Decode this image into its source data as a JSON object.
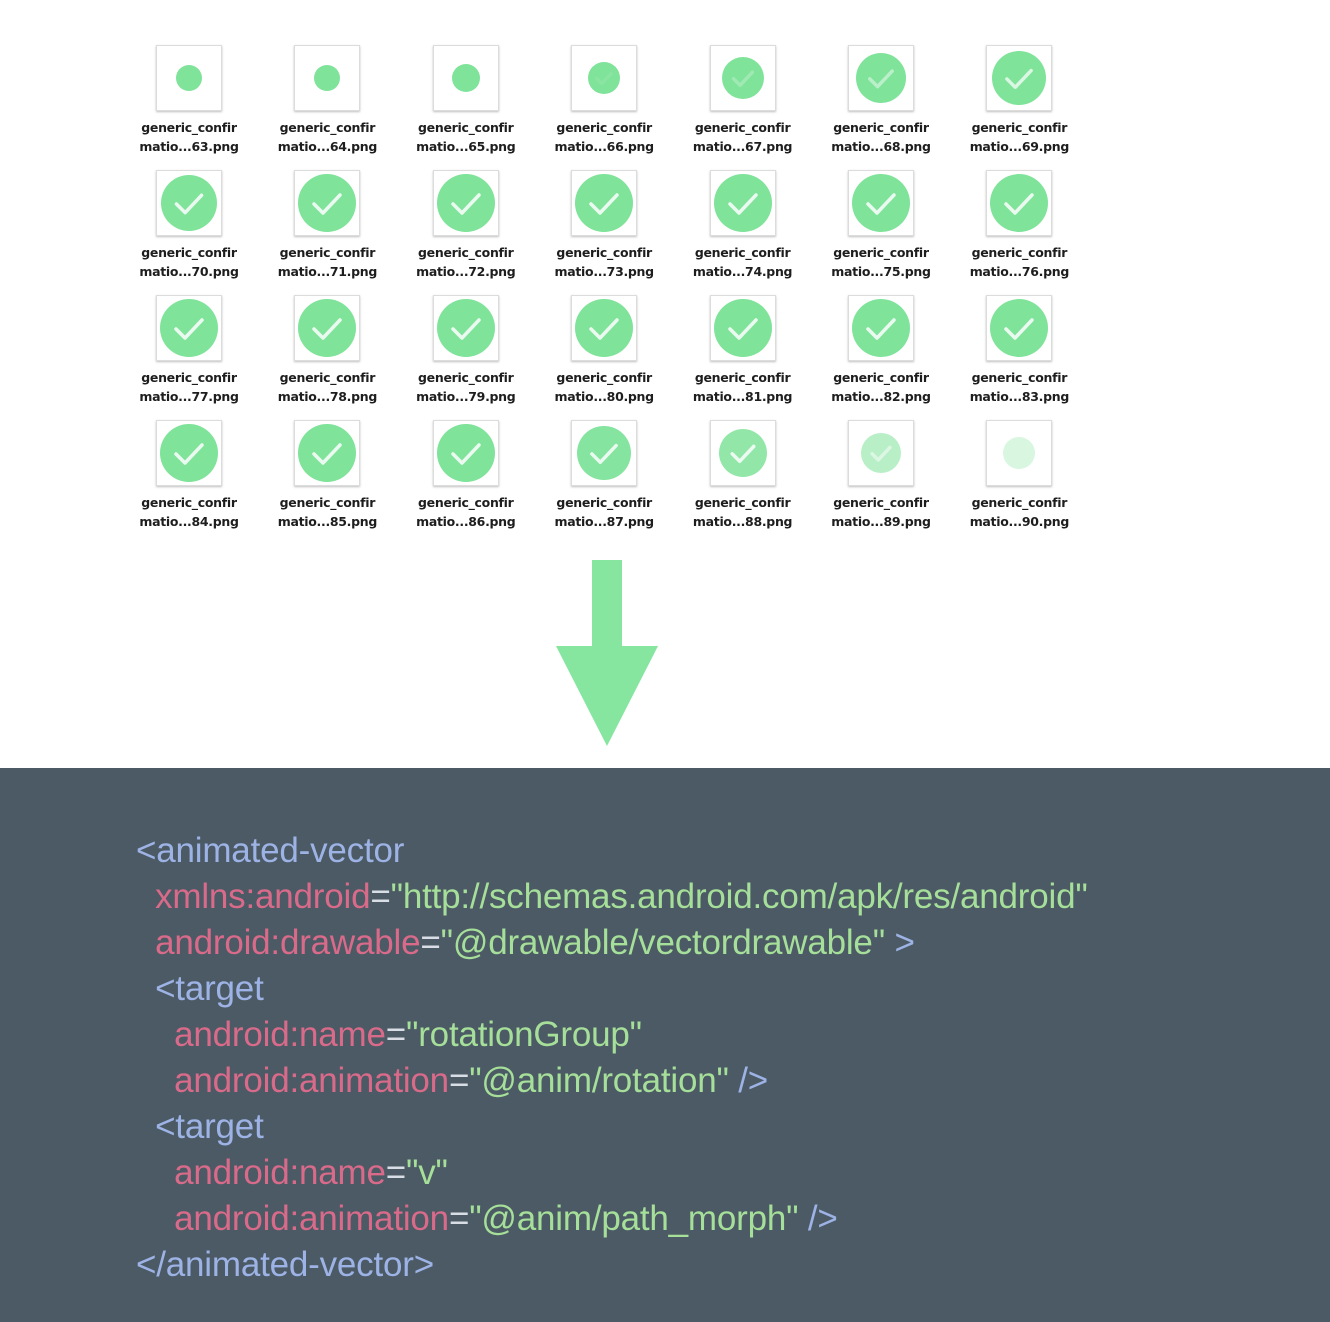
{
  "files": [
    {
      "line1": "generic_confir",
      "line2": "matio...63.png",
      "icon": "confirmation-frame-icon",
      "radius": 13,
      "check": 0,
      "opacity": 1
    },
    {
      "line1": "generic_confir",
      "line2": "matio...64.png",
      "icon": "confirmation-frame-icon",
      "radius": 13,
      "check": 0,
      "opacity": 1
    },
    {
      "line1": "generic_confir",
      "line2": "matio...65.png",
      "icon": "confirmation-frame-icon",
      "radius": 14,
      "check": 0,
      "opacity": 1
    },
    {
      "line1": "generic_confir",
      "line2": "matio...66.png",
      "icon": "confirmation-frame-icon",
      "radius": 16,
      "check": 0.1,
      "opacity": 1
    },
    {
      "line1": "generic_confir",
      "line2": "matio...67.png",
      "icon": "confirmation-frame-icon",
      "radius": 21,
      "check": 0.3,
      "opacity": 1
    },
    {
      "line1": "generic_confir",
      "line2": "matio...68.png",
      "icon": "confirmation-frame-icon",
      "radius": 25,
      "check": 0.55,
      "opacity": 1
    },
    {
      "line1": "generic_confir",
      "line2": "matio...69.png",
      "icon": "confirmation-frame-icon",
      "radius": 27,
      "check": 0.85,
      "opacity": 1
    },
    {
      "line1": "generic_confir",
      "line2": "matio...70.png",
      "icon": "confirmation-frame-icon",
      "radius": 28,
      "check": 1,
      "opacity": 1
    },
    {
      "line1": "generic_confir",
      "line2": "matio...71.png",
      "icon": "confirmation-frame-icon",
      "radius": 29,
      "check": 1,
      "opacity": 1
    },
    {
      "line1": "generic_confir",
      "line2": "matio...72.png",
      "icon": "confirmation-frame-icon",
      "radius": 29,
      "check": 1,
      "opacity": 1
    },
    {
      "line1": "generic_confir",
      "line2": "matio...73.png",
      "icon": "confirmation-frame-icon",
      "radius": 29,
      "check": 1,
      "opacity": 1
    },
    {
      "line1": "generic_confir",
      "line2": "matio...74.png",
      "icon": "confirmation-frame-icon",
      "radius": 29,
      "check": 1,
      "opacity": 1
    },
    {
      "line1": "generic_confir",
      "line2": "matio...75.png",
      "icon": "confirmation-frame-icon",
      "radius": 29,
      "check": 1,
      "opacity": 1
    },
    {
      "line1": "generic_confir",
      "line2": "matio...76.png",
      "icon": "confirmation-frame-icon",
      "radius": 29,
      "check": 1,
      "opacity": 1
    },
    {
      "line1": "generic_confir",
      "line2": "matio...77.png",
      "icon": "confirmation-frame-icon",
      "radius": 29,
      "check": 1,
      "opacity": 1
    },
    {
      "line1": "generic_confir",
      "line2": "matio...78.png",
      "icon": "confirmation-frame-icon",
      "radius": 29,
      "check": 1,
      "opacity": 1
    },
    {
      "line1": "generic_confir",
      "line2": "matio...79.png",
      "icon": "confirmation-frame-icon",
      "radius": 29,
      "check": 1,
      "opacity": 1
    },
    {
      "line1": "generic_confir",
      "line2": "matio...80.png",
      "icon": "confirmation-frame-icon",
      "radius": 29,
      "check": 1,
      "opacity": 1
    },
    {
      "line1": "generic_confir",
      "line2": "matio...81.png",
      "icon": "confirmation-frame-icon",
      "radius": 29,
      "check": 1,
      "opacity": 1
    },
    {
      "line1": "generic_confir",
      "line2": "matio...82.png",
      "icon": "confirmation-frame-icon",
      "radius": 29,
      "check": 1,
      "opacity": 1
    },
    {
      "line1": "generic_confir",
      "line2": "matio...83.png",
      "icon": "confirmation-frame-icon",
      "radius": 29,
      "check": 1,
      "opacity": 1
    },
    {
      "line1": "generic_confir",
      "line2": "matio...84.png",
      "icon": "confirmation-frame-icon",
      "radius": 29,
      "check": 1,
      "opacity": 1
    },
    {
      "line1": "generic_confir",
      "line2": "matio...85.png",
      "icon": "confirmation-frame-icon",
      "radius": 29,
      "check": 1,
      "opacity": 1
    },
    {
      "line1": "generic_confir",
      "line2": "matio...86.png",
      "icon": "confirmation-frame-icon",
      "radius": 29,
      "check": 1,
      "opacity": 1
    },
    {
      "line1": "generic_confir",
      "line2": "matio...87.png",
      "icon": "confirmation-frame-icon",
      "radius": 27,
      "check": 1,
      "opacity": 0.95
    },
    {
      "line1": "generic_confir",
      "line2": "matio...88.png",
      "icon": "confirmation-frame-icon",
      "radius": 24,
      "check": 1,
      "opacity": 0.85
    },
    {
      "line1": "generic_confir",
      "line2": "matio...89.png",
      "icon": "confirmation-frame-icon",
      "radius": 20,
      "check": 0.6,
      "opacity": 0.55
    },
    {
      "line1": "generic_confir",
      "line2": "matio...90.png",
      "icon": "confirmation-frame-icon",
      "radius": 16,
      "check": 0,
      "opacity": 0.3
    }
  ],
  "arrow": {
    "icon": "down-arrow-icon",
    "color": "#86e6a0"
  },
  "code": {
    "lines": [
      [
        {
          "t": "<animated-vector",
          "c": "tag"
        }
      ],
      [
        {
          "t": "  "
        },
        {
          "t": "xmlns:android",
          "c": "attr"
        },
        {
          "t": "=",
          "c": "eq"
        },
        {
          "t": "\"http://schemas.android.com/apk/res/android\"",
          "c": "str"
        }
      ],
      [
        {
          "t": "  "
        },
        {
          "t": "android:drawable",
          "c": "attr"
        },
        {
          "t": "=",
          "c": "eq"
        },
        {
          "t": "\"@drawable/vectordrawable\"",
          "c": "str"
        },
        {
          "t": " >",
          "c": "tag"
        }
      ],
      [
        {
          "t": "  "
        },
        {
          "t": "<target",
          "c": "tag"
        }
      ],
      [
        {
          "t": "    "
        },
        {
          "t": "android:name",
          "c": "attr"
        },
        {
          "t": "=",
          "c": "eq"
        },
        {
          "t": "\"rotationGroup\"",
          "c": "str"
        }
      ],
      [
        {
          "t": "    "
        },
        {
          "t": "android:animation",
          "c": "attr"
        },
        {
          "t": "=",
          "c": "eq"
        },
        {
          "t": "\"@anim/rotation\"",
          "c": "str"
        },
        {
          "t": " />",
          "c": "tag"
        }
      ],
      [
        {
          "t": "  "
        },
        {
          "t": "<target",
          "c": "tag"
        }
      ],
      [
        {
          "t": "    "
        },
        {
          "t": "android:name",
          "c": "attr"
        },
        {
          "t": "=",
          "c": "eq"
        },
        {
          "t": "\"v\"",
          "c": "str"
        }
      ],
      [
        {
          "t": "    "
        },
        {
          "t": "android:animation",
          "c": "attr"
        },
        {
          "t": "=",
          "c": "eq"
        },
        {
          "t": "\"@anim/path_morph\"",
          "c": "str"
        },
        {
          "t": " />",
          "c": "tag"
        }
      ],
      [
        {
          "t": "</animated-vector>",
          "c": "tag"
        }
      ]
    ]
  },
  "colors": {
    "circle": "#7fe39a",
    "check": "#eafaf0",
    "code_bg": "#4b5a64",
    "tag": "#9db3e6",
    "attr": "#d96a8a",
    "string": "#a6df99"
  }
}
